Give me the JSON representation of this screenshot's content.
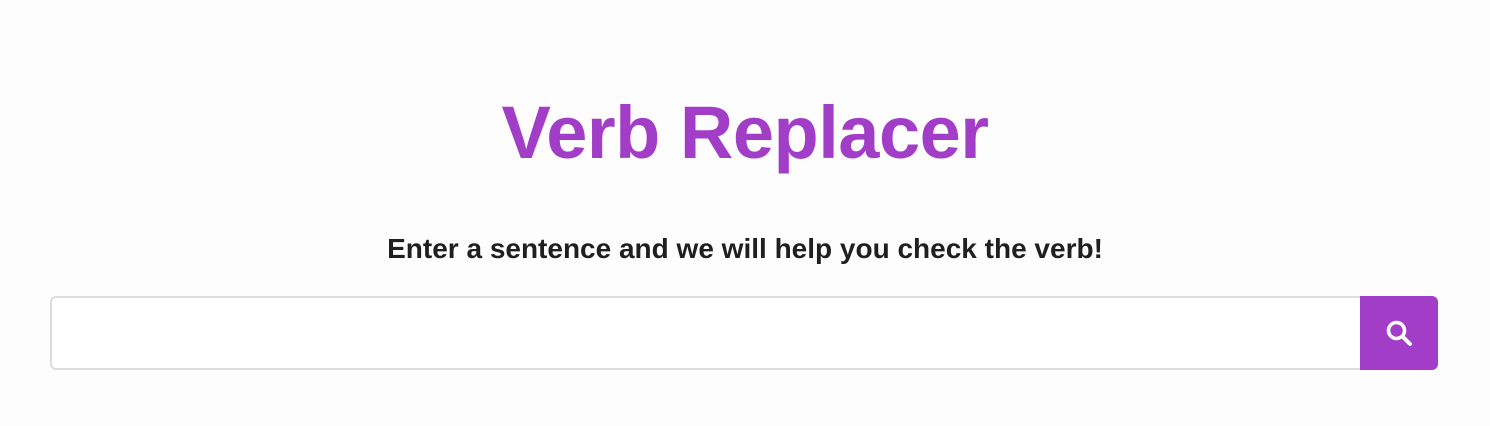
{
  "header": {
    "title": "Verb Replacer",
    "subtitle": "Enter a sentence and we will help you check the verb!"
  },
  "search": {
    "value": "",
    "placeholder": "",
    "button_icon": "search-icon"
  },
  "colors": {
    "accent": "#a23dc8",
    "text": "#1f1f1f",
    "border": "#dcdcdc",
    "background": "#fdfdfd"
  }
}
